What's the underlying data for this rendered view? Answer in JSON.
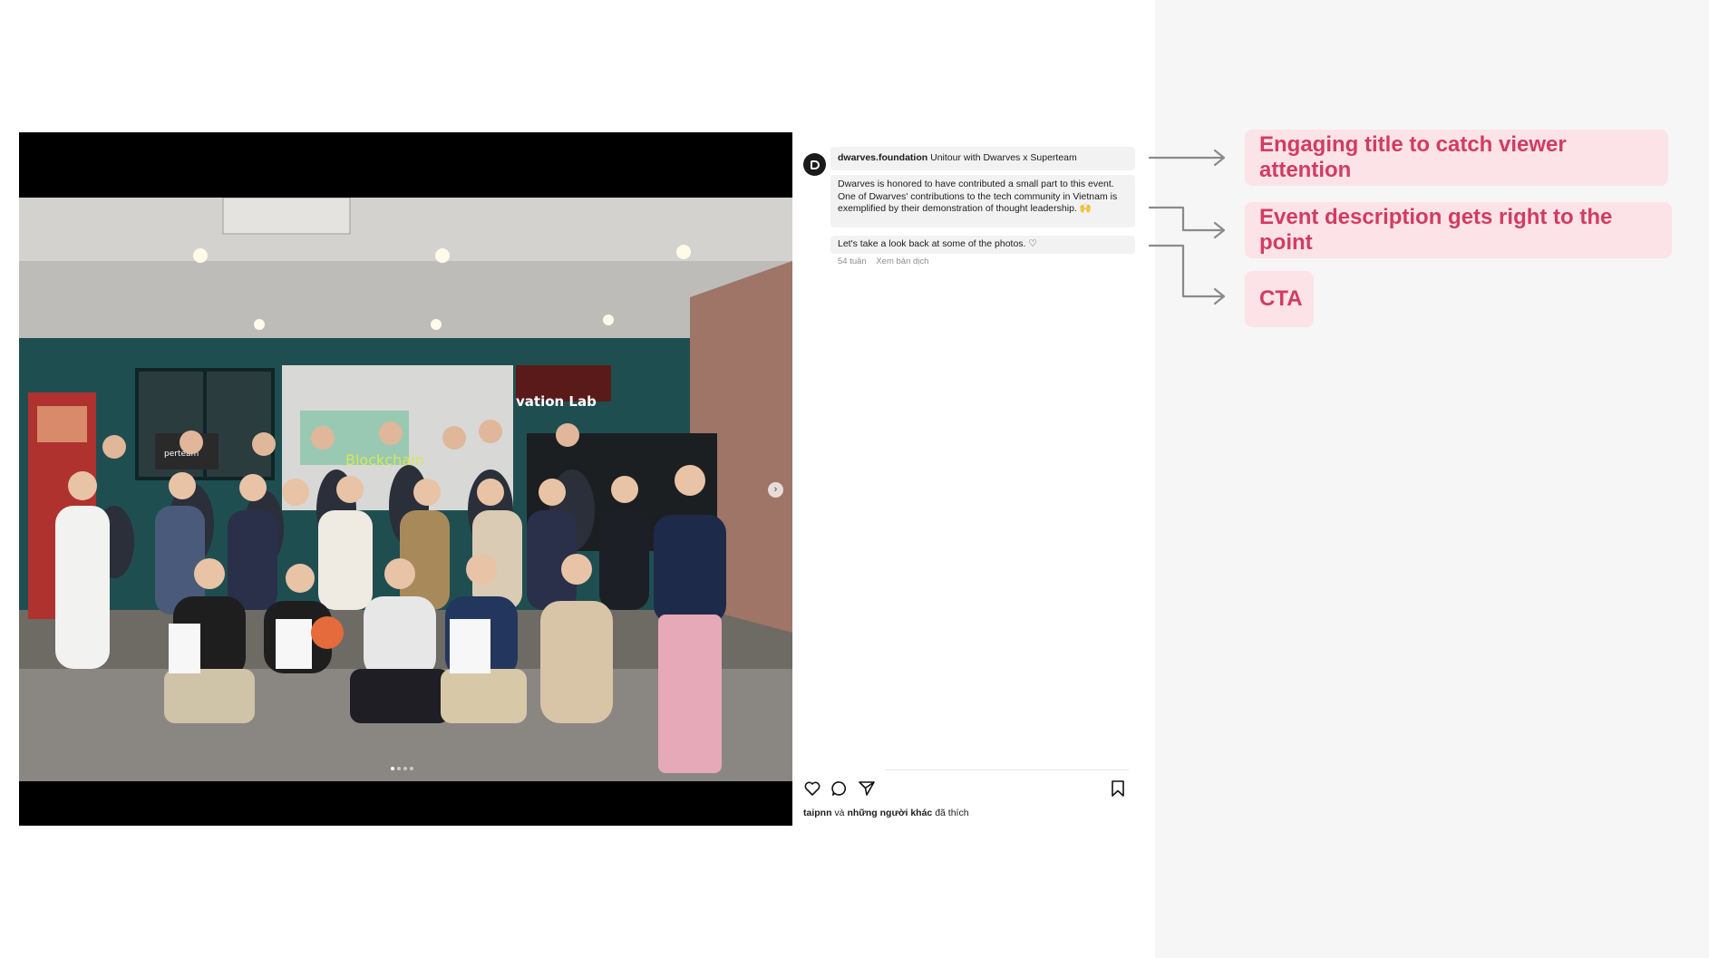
{
  "post": {
    "username": "dwarves.foundation",
    "title": "Unitour with Dwarves x Superteam",
    "description": "Dwarves is honored to have contributed a small part to this event. One of Dwarves' contributions to the tech community in Vietnam is exemplified by their demonstration of thought leadership. 🙌",
    "cta": "Let's take a look back at some of the photos. ♡",
    "time_ago": "54 tuần",
    "translate_link": "Xem bản dịch",
    "liked_by_user": "taipnn",
    "liked_by_connector": "và",
    "liked_by_others": "những người khác",
    "liked_suffix": "đã thích",
    "photo_sign": "vation Lab",
    "projection_text": "Blockchain",
    "banner_text": "perteam",
    "carousel": {
      "total_slides": 4,
      "active_slide": 1
    }
  },
  "icons": {
    "avatar": "dwarves-logo-icon",
    "like": "heart-icon",
    "comment": "comment-icon",
    "share": "paper-plane-icon",
    "save": "bookmark-icon",
    "next": "chevron-right-icon"
  },
  "annotations": [
    {
      "label": "Engaging title to catch viewer attention"
    },
    {
      "label": "Event description gets right to the point"
    },
    {
      "label": "CTA"
    }
  ],
  "colors": {
    "annotation_bg": "#fbe3e7",
    "annotation_text": "#d23c62",
    "connector": "#8a8a8a",
    "panel_bg": "#f6f6f6"
  }
}
